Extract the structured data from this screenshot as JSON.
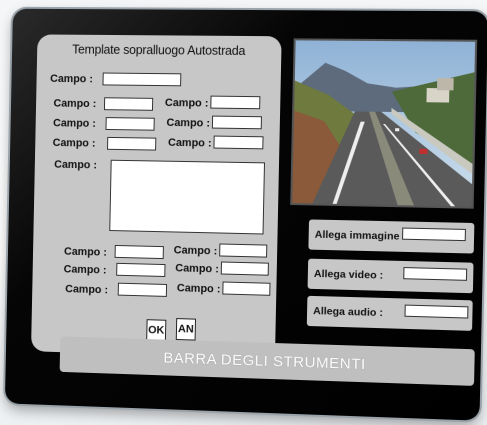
{
  "form": {
    "title": "Template sopralluogo Autostrada",
    "field_label": "Campo :",
    "textarea_label": "Campo :",
    "ok_label": "OK",
    "cancel_label": "AN"
  },
  "attachments": {
    "image_label": "Allega immagine :",
    "video_label": "Allega video :",
    "audio_label": "Allega audio :"
  },
  "toolbar": {
    "label": "BARRA DEGLI STRUMENTI"
  },
  "photo": {
    "description_icon": "highway-photo"
  },
  "colors": {
    "frame": "#000000",
    "panel": "#c7c7c7",
    "field": "#ffffff"
  }
}
